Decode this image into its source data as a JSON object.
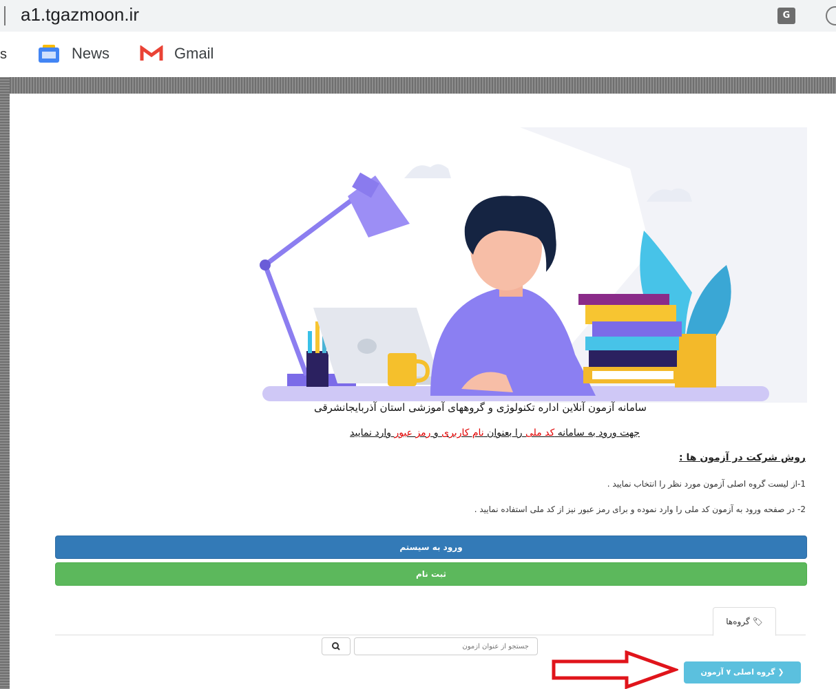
{
  "browser": {
    "address": "a1.tgazmoon.ir",
    "bookmarks_partial": "s",
    "bookmarks": [
      {
        "label": "News",
        "icon": "google-news-icon"
      },
      {
        "label": "Gmail",
        "icon": "gmail-icon"
      }
    ]
  },
  "main": {
    "system_title": "سامانه آزمون آنلاین اداره تکنولوژی و گروههای آموزشی استان آذربایجانشرقی",
    "login_note": {
      "prefix": "جهت ورود به سامانه ",
      "national_code": "کد ملی",
      "middle": " را بعنوان ",
      "username": "نام کاربری",
      "and": " و ",
      "password": "رمز عبور",
      "suffix": " وارد نمایید"
    },
    "how_heading": "روش شرکت در آزمون ها :",
    "steps": [
      "1-از لیست گروه اصلی آزمون مورد نظر را انتخاب نمایید .",
      "2- در صفحه ورود به آزمون کد ملی را وارد نموده و برای رمز عبور نیز از کد ملی استفاده نمایید ."
    ],
    "login_button": "ورود به سیستم",
    "register_button": "ثبت نام",
    "tab_label": "گروه‌ها",
    "search_placeholder": "جستجو از عنوان آزمون",
    "group_button": "گروه اصلی  ۷ آزمون"
  },
  "colors": {
    "primary": "#337ab7",
    "success": "#5cb85c",
    "info": "#5bc0de",
    "highlight_red": "#e00000"
  }
}
